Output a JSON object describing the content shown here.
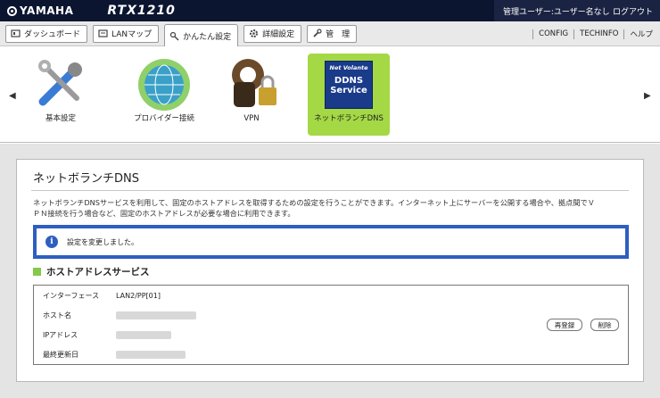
{
  "header": {
    "brand": "YAMAHA",
    "product": "RTX1210",
    "user_label": "管理ユーザー:ユーザー名なし",
    "logout": "ログアウト"
  },
  "nav": {
    "tabs": [
      {
        "label": "ダッシュボード",
        "icon": "dashboard-icon"
      },
      {
        "label": "LANマップ",
        "icon": "lan-map-icon"
      },
      {
        "label": "かんたん設定",
        "icon": "easy-setup-icon",
        "active": true
      },
      {
        "label": "詳細設定",
        "icon": "gear-icon"
      },
      {
        "label": "管　理",
        "icon": "wrench-icon"
      }
    ],
    "links": [
      "CONFIG",
      "TECHINFO",
      "ヘルプ"
    ]
  },
  "icons": [
    {
      "label": "基本設定",
      "icon": "tools-icon"
    },
    {
      "label": "プロバイダー接続",
      "icon": "globe-icon"
    },
    {
      "label": "VPN",
      "icon": "keys-lock-icon"
    },
    {
      "label": "ネットボランチDNS",
      "icon": "ddns-service-icon",
      "selected": true,
      "badge_top": "Net Volante",
      "badge_mid": "DDNS",
      "badge_bot": "Service"
    }
  ],
  "page": {
    "title": "ネットボランチDNS",
    "description_line1": "ネットボランチDNSサービスを利用して、固定のホストアドレスを取得するための設定を行うことができます。インターネット上にサーバーを公開する場合や、拠点間でＶ",
    "description_line2": "ＰＮ接続を行う場合など、固定のホストアドレスが必要な場合に利用できます。",
    "notice": "設定を変更しました。",
    "section": "ホストアドレスサービス"
  },
  "table": {
    "rows": [
      {
        "key": "インターフェース",
        "value": "LAN2/PP[01]"
      },
      {
        "key": "ホスト名",
        "value": ""
      },
      {
        "key": "IPアドレス",
        "value": ""
      },
      {
        "key": "最終更新日",
        "value": ""
      }
    ],
    "btn_reregister": "再登録",
    "btn_delete": "削除"
  },
  "colors": {
    "accent": "#2e5ec0",
    "selected": "#a4d845",
    "topbar": "#0b1530"
  }
}
